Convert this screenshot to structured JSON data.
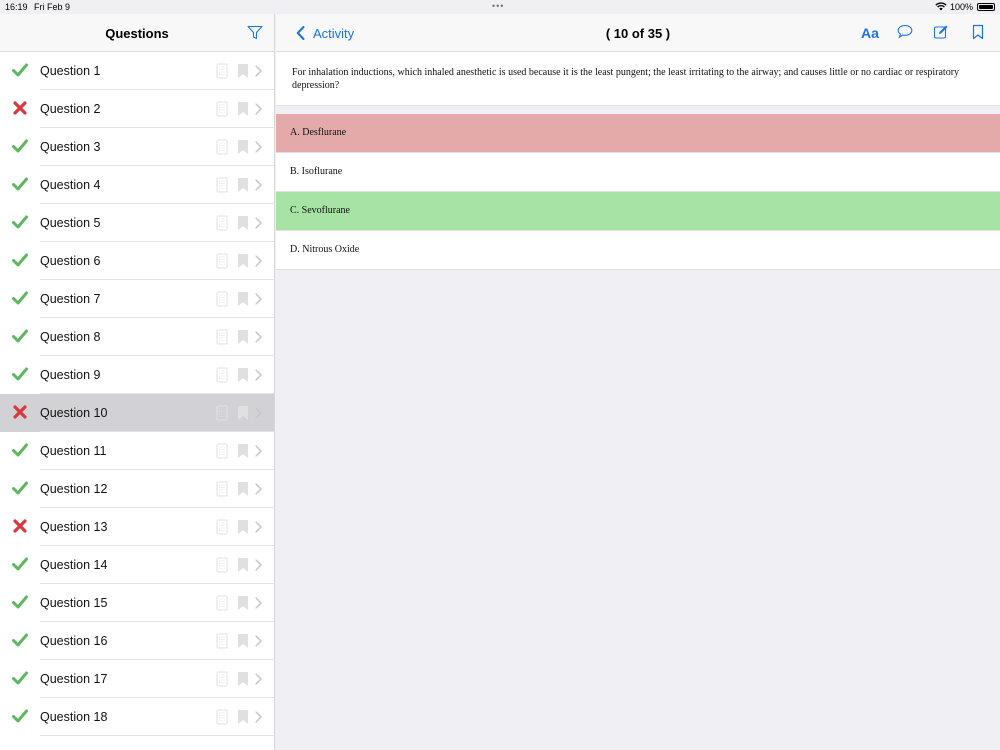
{
  "status": {
    "time": "16:19",
    "date": "Fri Feb 9",
    "battery": "100%"
  },
  "sidebar": {
    "title": "Questions",
    "items": [
      {
        "label": "Question 1",
        "status": "correct"
      },
      {
        "label": "Question 2",
        "status": "incorrect"
      },
      {
        "label": "Question 3",
        "status": "correct"
      },
      {
        "label": "Question 4",
        "status": "correct"
      },
      {
        "label": "Question 5",
        "status": "correct"
      },
      {
        "label": "Question 6",
        "status": "correct"
      },
      {
        "label": "Question 7",
        "status": "correct"
      },
      {
        "label": "Question 8",
        "status": "correct"
      },
      {
        "label": "Question 9",
        "status": "correct"
      },
      {
        "label": "Question 10",
        "status": "incorrect",
        "selected": true
      },
      {
        "label": "Question 11",
        "status": "correct"
      },
      {
        "label": "Question 12",
        "status": "correct"
      },
      {
        "label": "Question 13",
        "status": "incorrect"
      },
      {
        "label": "Question 14",
        "status": "correct"
      },
      {
        "label": "Question 15",
        "status": "correct"
      },
      {
        "label": "Question 16",
        "status": "correct"
      },
      {
        "label": "Question 17",
        "status": "correct"
      },
      {
        "label": "Question 18",
        "status": "correct"
      }
    ]
  },
  "nav": {
    "back_label": "Activity",
    "title": "( 10 of 35 )",
    "font_label": "Aa"
  },
  "question": {
    "text": "For inhalation inductions, which inhaled anesthetic is used because it is the least pungent; the least irritating to the airway; and causes little or no cardiac or respiratory depression?"
  },
  "answers": [
    {
      "text": "A. Desflurane",
      "state": "wrong"
    },
    {
      "text": "B. Isoflurane",
      "state": "none"
    },
    {
      "text": "C. Sevoflurane",
      "state": "right"
    },
    {
      "text": "D. Nitrous Oxide",
      "state": "none"
    }
  ],
  "colors": {
    "accent": "#1a73e8",
    "correct": "#5cb85c",
    "incorrect": "#d9363e",
    "answer_wrong_bg": "#e4aaaa",
    "answer_right_bg": "#a6e3a4",
    "selected_row_bg": "#d1d1d6"
  }
}
